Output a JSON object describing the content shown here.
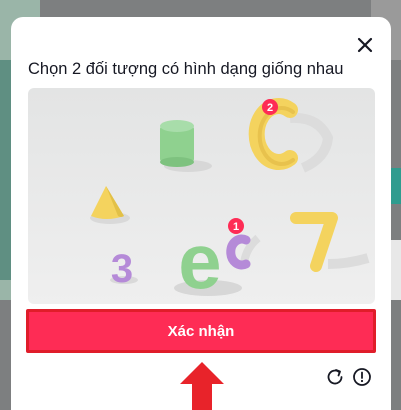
{
  "modal": {
    "title": "Chọn 2 đối tượng có hình dạng giống nhau",
    "confirm_label": "Xác nhận",
    "close_icon": "close-icon",
    "refresh_icon": "refresh-icon",
    "report_icon": "info-icon"
  },
  "puzzle": {
    "objects": [
      {
        "shape": "letter-c",
        "label": "c",
        "color": "#f4d35e",
        "selected_order": "2"
      },
      {
        "shape": "cylinder",
        "label": "",
        "color": "#8fd18f",
        "selected_order": ""
      },
      {
        "shape": "cone",
        "label": "",
        "color": "#f4d35e",
        "selected_order": ""
      },
      {
        "shape": "letter-c",
        "label": "c",
        "color": "#b58ad8",
        "selected_order": "1"
      },
      {
        "shape": "letter-e",
        "label": "e",
        "color": "#8fd18f",
        "selected_order": ""
      },
      {
        "shape": "number-3",
        "label": "3",
        "color": "#b58ad8",
        "selected_order": ""
      },
      {
        "shape": "number-7",
        "label": "7",
        "color": "#f4d35e",
        "selected_order": ""
      }
    ]
  },
  "colors": {
    "accent": "#fe2c55",
    "annotation": "#e8232a"
  }
}
